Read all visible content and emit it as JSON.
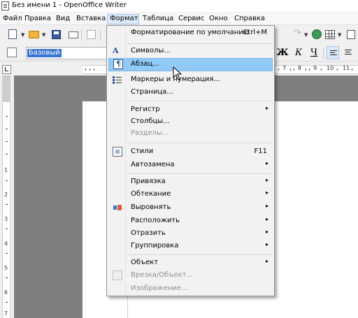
{
  "window": {
    "title": "Без имени 1 - OpenOffice Writer"
  },
  "menubar": {
    "items": [
      {
        "label": "Файл"
      },
      {
        "label": "Правка"
      },
      {
        "label": "Вид"
      },
      {
        "label": "Вставка"
      },
      {
        "label": "Формат"
      },
      {
        "label": "Таблица"
      },
      {
        "label": "Сервис"
      },
      {
        "label": "Окно"
      },
      {
        "label": "Справка"
      }
    ],
    "active": "Формат"
  },
  "formatting": {
    "paragraph_style": "Базовый",
    "bold_glyph": "Ж",
    "italic_glyph": "К",
    "underline_glyph": "Ч"
  },
  "ruler": {
    "h_numbers": [
      "7",
      "8",
      "9",
      "10",
      "11"
    ],
    "v_numbers": [
      "1",
      "2",
      "3",
      "4",
      "5",
      "6",
      "7"
    ]
  },
  "format_menu": {
    "items": [
      {
        "label": "Форматирование по умолчанию",
        "shortcut": "Ctrl+M"
      },
      {
        "label": "Символы...",
        "icon": "font-icon"
      },
      {
        "label": "Абзац...",
        "icon": "paragraph-icon",
        "highlighted": true
      },
      {
        "label": "Маркеры и нумерация...",
        "icon": "bullets-icon"
      },
      {
        "label": "Страница..."
      },
      {
        "label": "Регистр",
        "submenu": true
      },
      {
        "label": "Столбцы..."
      },
      {
        "label": "Разделы...",
        "disabled": true
      },
      {
        "label": "Стили",
        "shortcut": "F11",
        "icon": "styles-icon"
      },
      {
        "label": "Автозамена",
        "submenu": true
      },
      {
        "label": "Привязка",
        "submenu": true
      },
      {
        "label": "Обтекание",
        "submenu": true
      },
      {
        "label": "Выровнять",
        "submenu": true,
        "icon": "align-objects-icon"
      },
      {
        "label": "Расположить",
        "submenu": true
      },
      {
        "label": "Отразить",
        "submenu": true
      },
      {
        "label": "Группировка",
        "submenu": true
      },
      {
        "label": "Объект",
        "submenu": true
      },
      {
        "label": "Врезка/Объект...",
        "disabled": true,
        "icon": "frame-icon"
      },
      {
        "label": "Изображение...",
        "disabled": true
      }
    ],
    "submenu_arrow": "▸"
  },
  "colors": {
    "highlight": "#91c9f7",
    "selection": "#3874d1",
    "workspace": "#7f7f7f"
  }
}
